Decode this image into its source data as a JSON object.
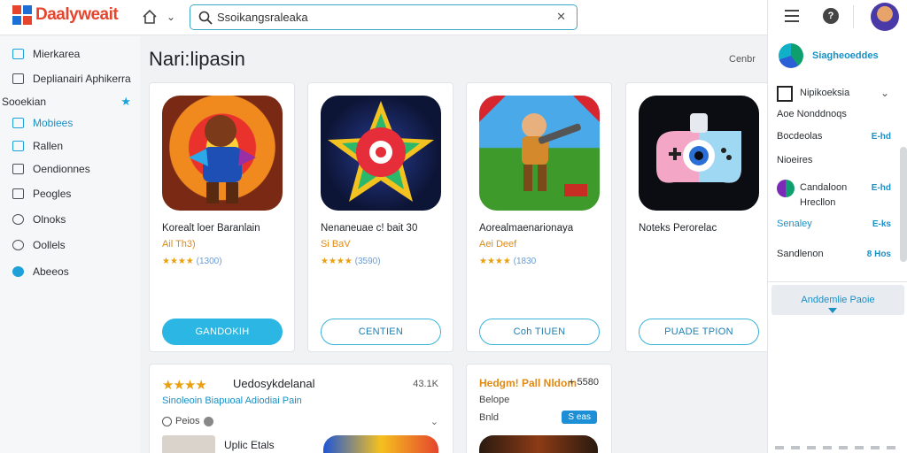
{
  "app": {
    "logo_text": "Daalyweait"
  },
  "search": {
    "value": "Ssoikangsraleaka",
    "placeholder": ""
  },
  "sidebar": {
    "items": [
      {
        "label": "Mierkarea",
        "active": false
      },
      {
        "label": "Deplianairi Aphikerra",
        "active": false
      },
      {
        "label": "Sooekian",
        "active": false
      },
      {
        "label": "Mobiees",
        "active": true
      },
      {
        "label": "Rallen",
        "active": false
      },
      {
        "label": "Oendionnes",
        "active": false
      },
      {
        "label": "Peogles",
        "active": false
      },
      {
        "label": "Olnoks",
        "active": false
      },
      {
        "label": "Oollels",
        "active": false
      },
      {
        "label": "Abeeos",
        "active": false
      }
    ]
  },
  "main": {
    "title": "Nari:lipasin",
    "center_link": "Cenbr",
    "cards": [
      {
        "title": "Korealt loer Baranlain",
        "meta": "Ail Th3)",
        "rating": "★★★★",
        "rating_count": "(1300)",
        "button": "GANDOKIH",
        "button_style": "primary"
      },
      {
        "title": "Nenaneuae c! bait 30",
        "meta": "Si BaV",
        "rating": "★★★★",
        "rating_count": "(3590)",
        "button": "CENTIEN",
        "button_style": "outline"
      },
      {
        "title": "Aorealmaenarionaya",
        "meta": "Aei Deef",
        "rating": "★★★★",
        "rating_count": "(1830",
        "button": "Coh TIUEN",
        "button_style": "outline"
      },
      {
        "title": "Noteks Perorelac",
        "meta": "",
        "rating": "",
        "rating_count": "",
        "button": "PUADE TPION",
        "button_style": "outline"
      }
    ],
    "bottom_left": {
      "stars": "★★★★",
      "title": "Uedosykdelanal",
      "count": "43.1K",
      "link": "Sinoleoin Biapuoal Adiodiai Pain",
      "price_label": "Peios"
    },
    "bottom_name": "Uplic Etals",
    "bottom_mid": {
      "title": "Hedgm! Pall Nldom",
      "extra": "+ 5580",
      "label": "Belope",
      "brand": "Bnld",
      "badge": "S eas"
    }
  },
  "right_panel": {
    "header_label": "Siagheoeddes",
    "rows": [
      {
        "label": "Nipikoeksia",
        "value": ""
      },
      {
        "label": "Aoe Nonddnoqs",
        "value": ""
      },
      {
        "label": "Bocdeolas",
        "value": "E-hd"
      },
      {
        "label": "Nioeires",
        "value": ""
      },
      {
        "label": "Candaloon",
        "value": "E-hd"
      },
      {
        "label": "Hrecllon",
        "value": ""
      },
      {
        "label": "Senaley",
        "value": "E-ks"
      },
      {
        "label": "Sandlenon",
        "value": "8 Hos"
      }
    ],
    "cta": "Anddemlie Paoie"
  }
}
